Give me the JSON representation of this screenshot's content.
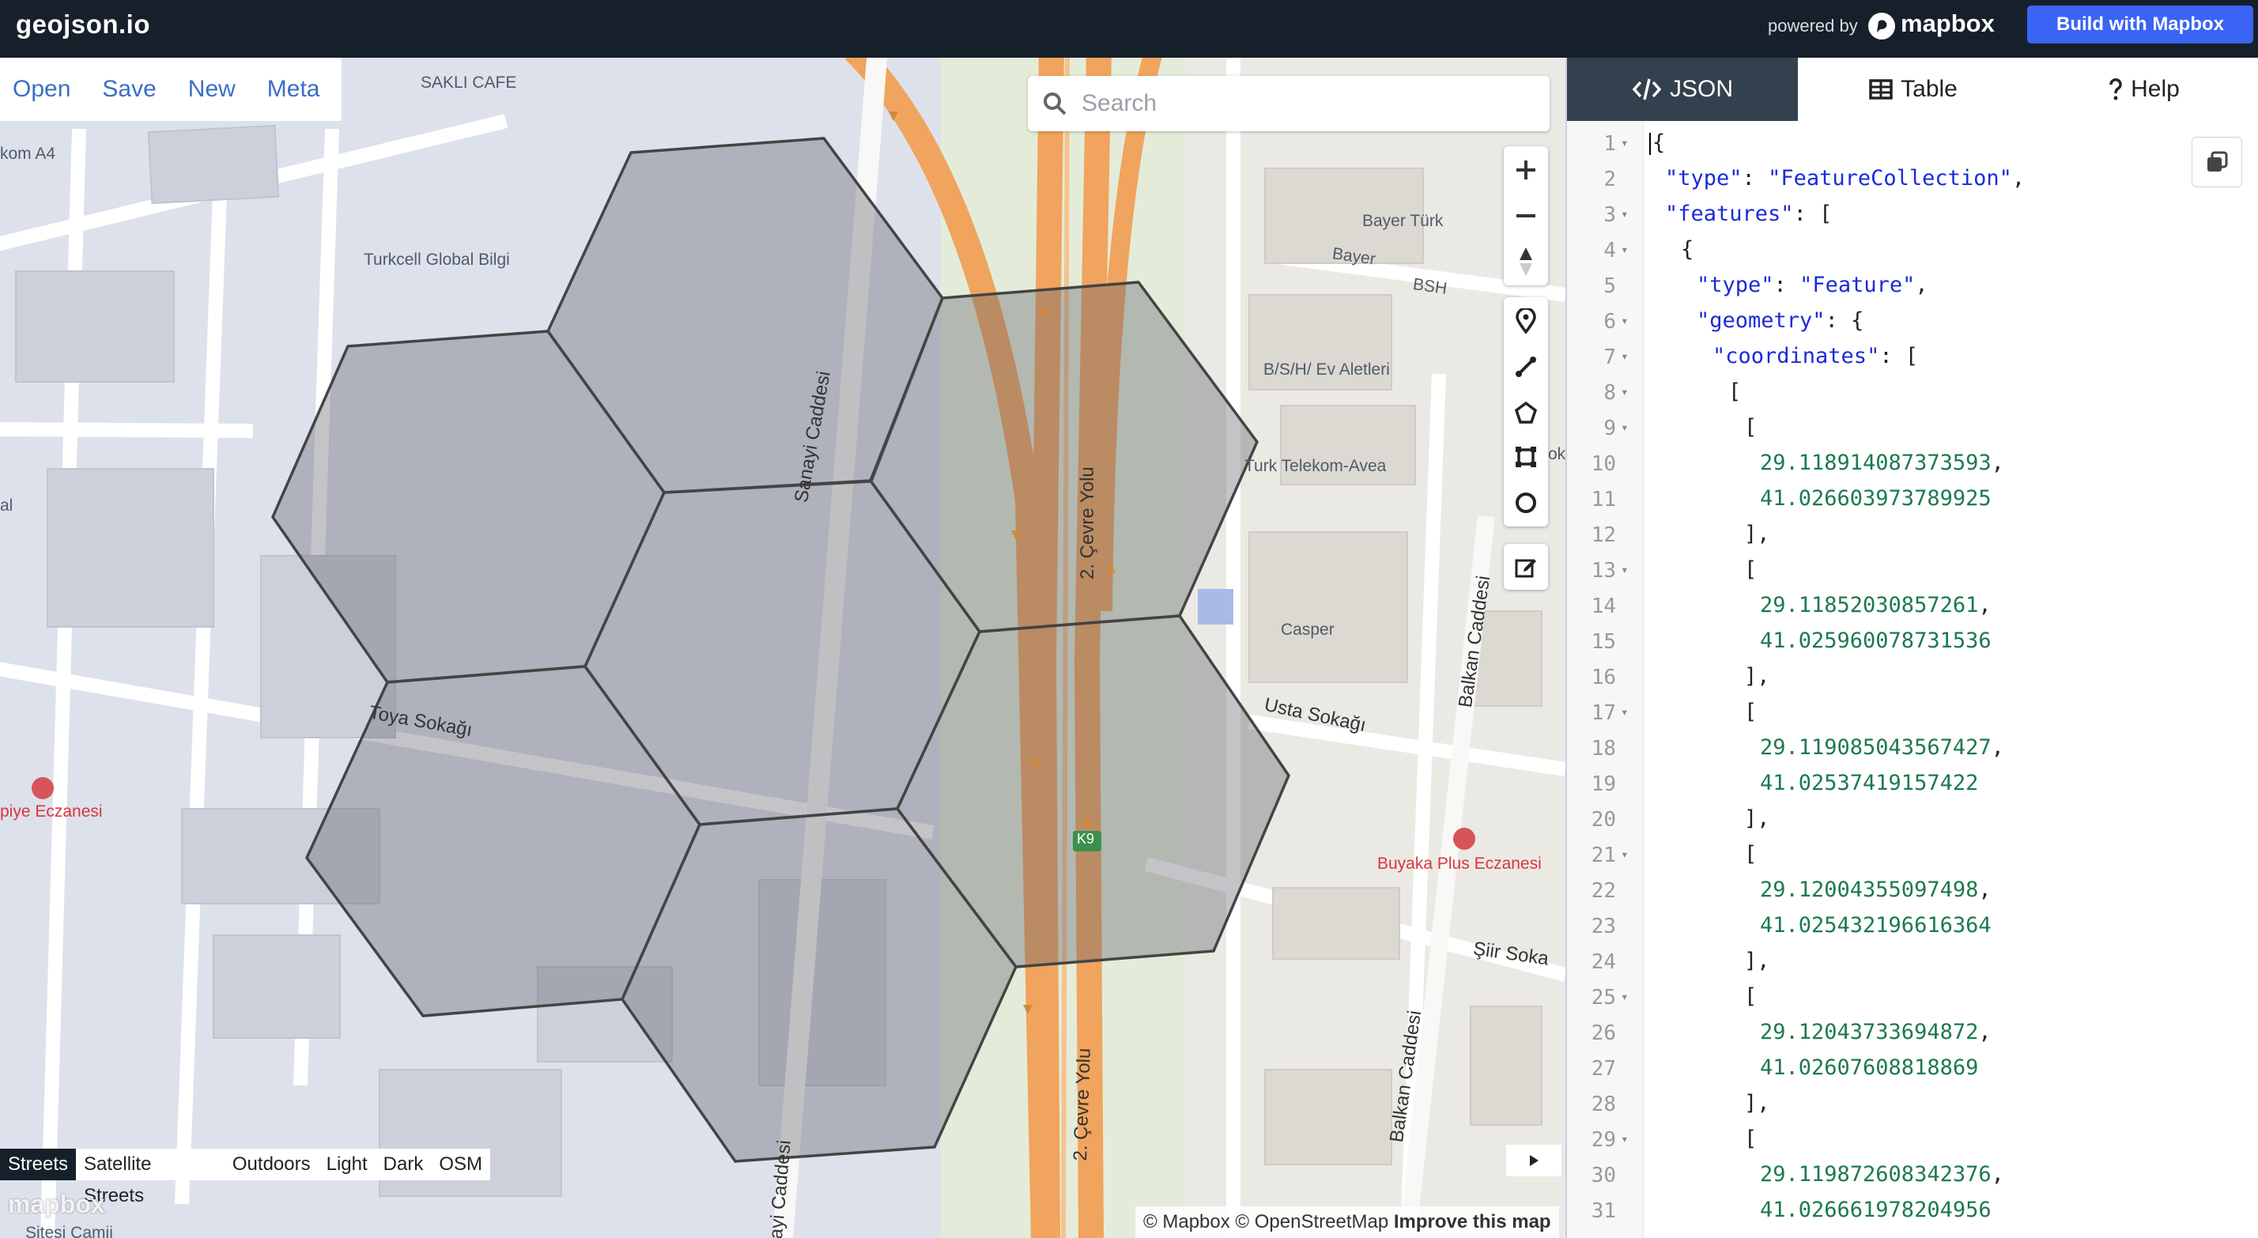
{
  "header": {
    "brand": "geojson.io",
    "powered_by": "powered by",
    "mapbox_word": "mapbox",
    "build_button": "Build with Mapbox",
    "accent_color": "#3a64f4",
    "bar_color": "#16202a"
  },
  "file_menu": [
    "Open",
    "Save",
    "New",
    "Meta"
  ],
  "search": {
    "placeholder": "Search",
    "icon": "search-icon"
  },
  "map_controls": {
    "zoom": [
      "zoom-in-icon",
      "zoom-out-icon",
      "compass-icon"
    ],
    "draw": [
      "draw-marker-icon",
      "draw-line-icon",
      "draw-polygon-icon",
      "draw-rectangle-icon",
      "draw-circle-icon"
    ],
    "edit": [
      "edit-icon"
    ]
  },
  "map_labels": {
    "sakli_cafe": "SAKLI CAFE",
    "kom": "kom A4",
    "turkcell": "Turkcell Global Bilgi",
    "bayer_turk": "Bayer Türk",
    "bayer": "Bayer",
    "bsh": "BSH",
    "bsh_ev": "B/S/H/ Ev Aletleri",
    "telekom": "Turk Telekom-Avea",
    "ok": "ok",
    "casper": "Casper",
    "al": "al",
    "sanayi": "Sanayi Caddesi",
    "cevre_top": "2. Çevre Yolu",
    "cevre_bottom": "2. Çevre Yolu",
    "balkan_top": "Balkan Caddesi",
    "balkan_bottom": "Balkan Caddesi",
    "usta": "Usta Sokağı",
    "toya": "Toya Sokağı",
    "eczane_left": "piye Eczanesi",
    "buyaka": "Buyaka Plus Eczanesi",
    "siir": "Şiir Soka",
    "k9": "K9",
    "sanayi_bottom": "ayi Caddesi",
    "sitesi": "Sitesi Camii"
  },
  "style_options": [
    "Streets",
    "Satellite Streets",
    "Outdoors",
    "Light",
    "Dark",
    "OSM"
  ],
  "active_style": "Streets",
  "attribution": {
    "mapbox": "© Mapbox",
    "osm": "© OpenStreetMap",
    "improve": "Improve this map"
  },
  "watermark": "mapbox",
  "tabs": [
    {
      "label": "JSON",
      "icon": "code-icon"
    },
    {
      "label": "Table",
      "icon": "table-icon"
    },
    {
      "label": "Help",
      "icon": "help-icon"
    }
  ],
  "code_lines": [
    {
      "n": "1",
      "fold": true,
      "indent": 0,
      "parts": [
        [
          "p",
          "{"
        ]
      ]
    },
    {
      "n": "2",
      "fold": false,
      "indent": 1,
      "parts": [
        [
          "k",
          "\"type\""
        ],
        [
          "p",
          ": "
        ],
        [
          "s",
          "\"FeatureCollection\""
        ],
        [
          "p",
          ","
        ]
      ]
    },
    {
      "n": "3",
      "fold": true,
      "indent": 1,
      "parts": [
        [
          "k",
          "\"features\""
        ],
        [
          "p",
          ": ["
        ]
      ]
    },
    {
      "n": "4",
      "fold": true,
      "indent": 2,
      "parts": [
        [
          "p",
          "{"
        ]
      ]
    },
    {
      "n": "5",
      "fold": false,
      "indent": 3,
      "parts": [
        [
          "k",
          "\"type\""
        ],
        [
          "p",
          ": "
        ],
        [
          "s",
          "\"Feature\""
        ],
        [
          "p",
          ","
        ]
      ]
    },
    {
      "n": "6",
      "fold": true,
      "indent": 3,
      "parts": [
        [
          "k",
          "\"geometry\""
        ],
        [
          "p",
          ": {"
        ]
      ]
    },
    {
      "n": "7",
      "fold": true,
      "indent": 4,
      "parts": [
        [
          "k",
          "\"coordinates\""
        ],
        [
          "p",
          ": ["
        ]
      ]
    },
    {
      "n": "8",
      "fold": true,
      "indent": 5,
      "parts": [
        [
          "p",
          "["
        ]
      ]
    },
    {
      "n": "9",
      "fold": true,
      "indent": 6,
      "parts": [
        [
          "p",
          "["
        ]
      ]
    },
    {
      "n": "10",
      "fold": false,
      "indent": 7,
      "parts": [
        [
          "n",
          "29.118914087373593"
        ],
        [
          "p",
          ","
        ]
      ]
    },
    {
      "n": "11",
      "fold": false,
      "indent": 7,
      "parts": [
        [
          "n",
          "41.026603973789925"
        ]
      ]
    },
    {
      "n": "12",
      "fold": false,
      "indent": 6,
      "parts": [
        [
          "p",
          "],"
        ]
      ]
    },
    {
      "n": "13",
      "fold": true,
      "indent": 6,
      "parts": [
        [
          "p",
          "["
        ]
      ]
    },
    {
      "n": "14",
      "fold": false,
      "indent": 7,
      "parts": [
        [
          "n",
          "29.11852030857261"
        ],
        [
          "p",
          ","
        ]
      ]
    },
    {
      "n": "15",
      "fold": false,
      "indent": 7,
      "parts": [
        [
          "n",
          "41.025960078731536"
        ]
      ]
    },
    {
      "n": "16",
      "fold": false,
      "indent": 6,
      "parts": [
        [
          "p",
          "],"
        ]
      ]
    },
    {
      "n": "17",
      "fold": true,
      "indent": 6,
      "parts": [
        [
          "p",
          "["
        ]
      ]
    },
    {
      "n": "18",
      "fold": false,
      "indent": 7,
      "parts": [
        [
          "n",
          "29.119085043567427"
        ],
        [
          "p",
          ","
        ]
      ]
    },
    {
      "n": "19",
      "fold": false,
      "indent": 7,
      "parts": [
        [
          "n",
          "41.02537419157422"
        ]
      ]
    },
    {
      "n": "20",
      "fold": false,
      "indent": 6,
      "parts": [
        [
          "p",
          "],"
        ]
      ]
    },
    {
      "n": "21",
      "fold": true,
      "indent": 6,
      "parts": [
        [
          "p",
          "["
        ]
      ]
    },
    {
      "n": "22",
      "fold": false,
      "indent": 7,
      "parts": [
        [
          "n",
          "29.12004355097498"
        ],
        [
          "p",
          ","
        ]
      ]
    },
    {
      "n": "23",
      "fold": false,
      "indent": 7,
      "parts": [
        [
          "n",
          "41.025432196616364"
        ]
      ]
    },
    {
      "n": "24",
      "fold": false,
      "indent": 6,
      "parts": [
        [
          "p",
          "],"
        ]
      ]
    },
    {
      "n": "25",
      "fold": true,
      "indent": 6,
      "parts": [
        [
          "p",
          "["
        ]
      ]
    },
    {
      "n": "26",
      "fold": false,
      "indent": 7,
      "parts": [
        [
          "n",
          "29.12043733694872"
        ],
        [
          "p",
          ","
        ]
      ]
    },
    {
      "n": "27",
      "fold": false,
      "indent": 7,
      "parts": [
        [
          "n",
          "41.02607608818869"
        ]
      ]
    },
    {
      "n": "28",
      "fold": false,
      "indent": 6,
      "parts": [
        [
          "p",
          "],"
        ]
      ]
    },
    {
      "n": "29",
      "fold": true,
      "indent": 6,
      "parts": [
        [
          "p",
          "["
        ]
      ]
    },
    {
      "n": "30",
      "fold": false,
      "indent": 7,
      "parts": [
        [
          "n",
          "29.119872608342376"
        ],
        [
          "p",
          ","
        ]
      ]
    },
    {
      "n": "31",
      "fold": false,
      "indent": 7,
      "parts": [
        [
          "n",
          "41.026661978204956"
        ]
      ]
    }
  ],
  "copy_button_icon": "copy-icon"
}
